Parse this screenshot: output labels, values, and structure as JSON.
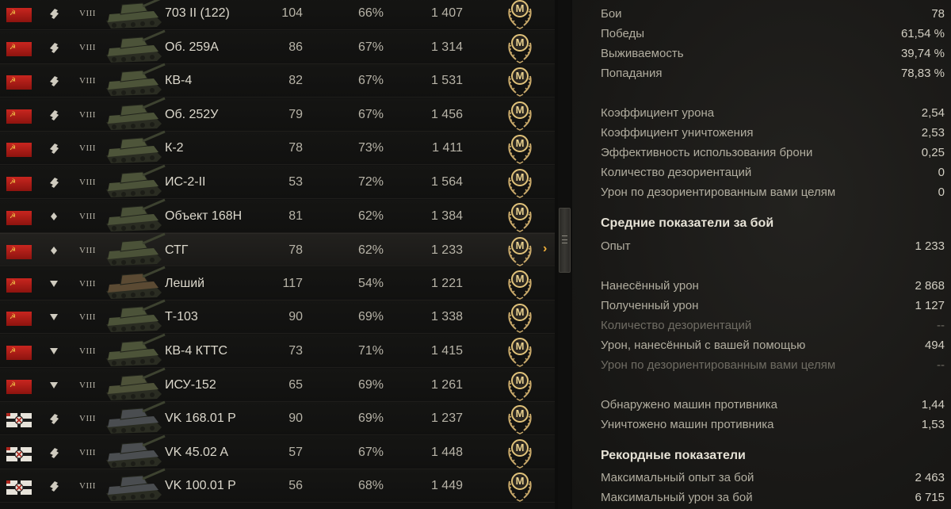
{
  "vehicles": [
    {
      "nation": "ussr",
      "role": "heavy",
      "tier": "VIII",
      "name": "703 II (122)",
      "battles": "104",
      "wins": "66%",
      "exp": "1 407",
      "tank_color": "#4a5238"
    },
    {
      "nation": "ussr",
      "role": "heavy",
      "tier": "VIII",
      "name": "Об. 259А",
      "battles": "86",
      "wins": "67%",
      "exp": "1 314",
      "tank_color": "#4c5339"
    },
    {
      "nation": "ussr",
      "role": "heavy",
      "tier": "VIII",
      "name": "КВ-4",
      "battles": "82",
      "wins": "67%",
      "exp": "1 531",
      "tank_color": "#4d5439"
    },
    {
      "nation": "ussr",
      "role": "heavy",
      "tier": "VIII",
      "name": "Об. 252У",
      "battles": "79",
      "wins": "67%",
      "exp": "1 456",
      "tank_color": "#4b5238"
    },
    {
      "nation": "ussr",
      "role": "heavy",
      "tier": "VIII",
      "name": "К-2",
      "battles": "78",
      "wins": "73%",
      "exp": "1 411",
      "tank_color": "#4e553a"
    },
    {
      "nation": "ussr",
      "role": "heavy",
      "tier": "VIII",
      "name": "ИС-2-II",
      "battles": "53",
      "wins": "72%",
      "exp": "1 564",
      "tank_color": "#4c5339"
    },
    {
      "nation": "ussr",
      "role": "medium",
      "tier": "VIII",
      "name": "Объект 168Н",
      "battles": "81",
      "wins": "62%",
      "exp": "1 384",
      "tank_color": "#4a5138"
    },
    {
      "nation": "ussr",
      "role": "medium",
      "tier": "VIII",
      "name": "СТГ",
      "battles": "78",
      "wins": "62%",
      "exp": "1 233",
      "tank_color": "#4b5238",
      "selected": true
    },
    {
      "nation": "ussr",
      "role": "td",
      "tier": "VIII",
      "name": "Леший",
      "battles": "117",
      "wins": "54%",
      "exp": "1 221",
      "tank_color": "#5b4a33"
    },
    {
      "nation": "ussr",
      "role": "td",
      "tier": "VIII",
      "name": "Т-103",
      "battles": "90",
      "wins": "69%",
      "exp": "1 338",
      "tank_color": "#4c5339"
    },
    {
      "nation": "ussr",
      "role": "td",
      "tier": "VIII",
      "name": "КВ-4 КТТС",
      "battles": "73",
      "wins": "71%",
      "exp": "1 415",
      "tank_color": "#4d5439"
    },
    {
      "nation": "ussr",
      "role": "td",
      "tier": "VIII",
      "name": "ИСУ-152",
      "battles": "65",
      "wins": "69%",
      "exp": "1 261",
      "tank_color": "#4e5239"
    },
    {
      "nation": "germany",
      "role": "heavy",
      "tier": "VIII",
      "name": "VK 168.01 P",
      "battles": "90",
      "wins": "69%",
      "exp": "1 237",
      "tank_color": "#4a4d50"
    },
    {
      "nation": "germany",
      "role": "heavy",
      "tier": "VIII",
      "name": "VK 45.02 A",
      "battles": "57",
      "wins": "67%",
      "exp": "1 448",
      "tank_color": "#4b4e51"
    },
    {
      "nation": "germany",
      "role": "heavy",
      "tier": "VIII",
      "name": "VK 100.01 P",
      "battles": "56",
      "wins": "68%",
      "exp": "1 449",
      "tank_color": "#4a4d50"
    }
  ],
  "medal_letter": "M",
  "selected_chevron": "›",
  "stats": {
    "general": [
      {
        "label": "Бои",
        "value": "78"
      },
      {
        "label": "Победы",
        "value": "61,54 %"
      },
      {
        "label": "Выживаемость",
        "value": "39,74 %"
      },
      {
        "label": "Попадания",
        "value": "78,83 %"
      }
    ],
    "coef": [
      {
        "label": "Коэффициент урона",
        "value": "2,54"
      },
      {
        "label": "Коэффициент уничтожения",
        "value": "2,53"
      },
      {
        "label": "Эффективность использования брони",
        "value": "0,25"
      },
      {
        "label": "Количество дезориентаций",
        "value": "0"
      },
      {
        "label": "Урон по дезориентированным вами целям",
        "value": "0"
      }
    ],
    "avg_title": "Средние показатели за бой",
    "avg_exp": [
      {
        "label": "Опыт",
        "value": "1 233"
      }
    ],
    "avg_damage": [
      {
        "label": "Нанесённый урон",
        "value": "2 868"
      },
      {
        "label": "Полученный урон",
        "value": "1 127"
      },
      {
        "label": "Количество дезориентаций",
        "value": "--",
        "dim": true
      },
      {
        "label": "Урон, нанесённый с вашей помощью",
        "value": "494"
      },
      {
        "label": "Урон по дезориентированным вами целям",
        "value": "--",
        "dim": true
      }
    ],
    "avg_spot": [
      {
        "label": "Обнаружено машин противника",
        "value": "1,44"
      },
      {
        "label": "Уничтожено машин противника",
        "value": "1,53"
      }
    ],
    "rec_title": "Рекордные показатели",
    "records": [
      {
        "label": "Максимальный опыт за бой",
        "value": "2 463"
      },
      {
        "label": "Максимальный урон за бой",
        "value": "6 715"
      }
    ]
  },
  "colors": {
    "accent": "#f2b03a",
    "ussr_flag": "#c8261f",
    "medal_gold": "#e0c27a"
  }
}
